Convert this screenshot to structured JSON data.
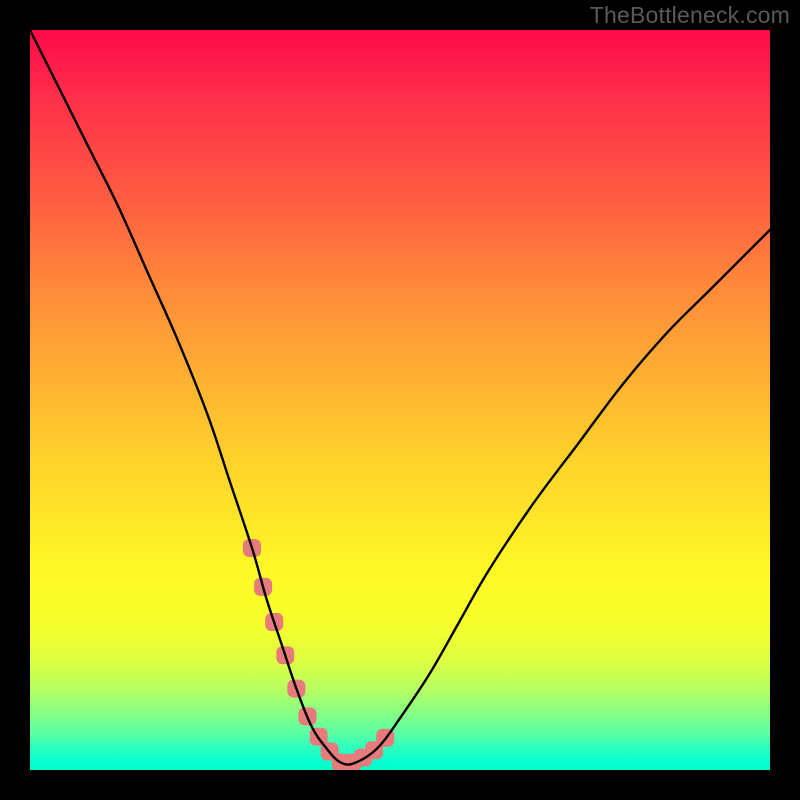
{
  "watermark": "TheBottleneck.com",
  "chart_data": {
    "type": "line",
    "title": "",
    "xlabel": "",
    "ylabel": "",
    "xlim": [
      0,
      100
    ],
    "ylim": [
      0,
      100
    ],
    "grid": false,
    "legend": false,
    "annotations": [],
    "series": [
      {
        "name": "curve",
        "x": [
          0,
          4,
          8,
          12,
          16,
          20,
          24,
          27,
          30,
          32,
          34,
          36,
          38,
          40,
          42,
          44,
          47,
          50,
          54,
          58,
          62,
          68,
          74,
          80,
          86,
          92,
          100
        ],
        "y": [
          100,
          92,
          84,
          76,
          67,
          58,
          48,
          39,
          30,
          23,
          17,
          11,
          6,
          3,
          1,
          1,
          3,
          7,
          13,
          20,
          27,
          36,
          44,
          52,
          59,
          65,
          73
        ]
      }
    ],
    "markers": [
      {
        "name": "marker-region",
        "x": [
          30,
          31.5,
          33,
          34.5,
          36,
          37.5,
          39,
          40.5,
          42,
          43.5,
          45,
          46.5,
          48
        ],
        "shape": "rounded-square"
      }
    ],
    "background": {
      "type": "vertical-gradient",
      "stops": [
        {
          "pos": 0.0,
          "color": "#ff0a49"
        },
        {
          "pos": 0.22,
          "color": "#ff5a42"
        },
        {
          "pos": 0.47,
          "color": "#ffb032"
        },
        {
          "pos": 0.73,
          "color": "#fff826"
        },
        {
          "pos": 0.89,
          "color": "#b8ff60"
        },
        {
          "pos": 1.0,
          "color": "#00ffc6"
        }
      ]
    }
  }
}
